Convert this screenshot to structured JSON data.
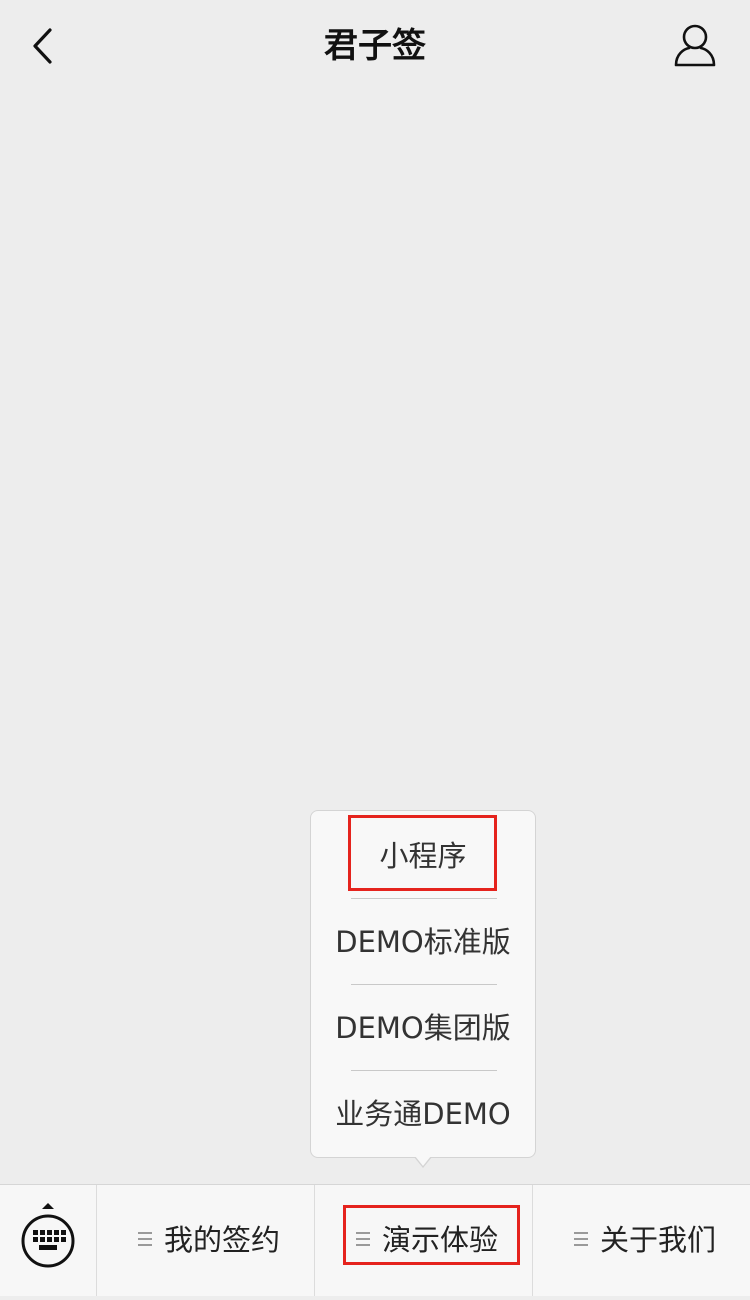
{
  "header": {
    "back_icon": "chevron-left-icon",
    "title": "君子签",
    "profile_icon": "user-icon"
  },
  "popup_menu": {
    "items": [
      {
        "label": "小程序",
        "highlighted": true
      },
      {
        "label": "DEMO标准版",
        "highlighted": false
      },
      {
        "label": "DEMO集团版",
        "highlighted": false
      },
      {
        "label": "业务通DEMO",
        "highlighted": false
      }
    ]
  },
  "bottom_bar": {
    "keyboard_icon": "keyboard-icon",
    "items": [
      {
        "label": "我的签约",
        "icon": "menu-icon",
        "highlighted": false
      },
      {
        "label": "演示体验",
        "icon": "menu-icon",
        "highlighted": true
      },
      {
        "label": "关于我们",
        "icon": "menu-icon",
        "highlighted": false
      }
    ]
  },
  "colors": {
    "background": "#ededed",
    "highlight": "#e5231d",
    "bar_background": "#f7f7f7",
    "popup_background": "#f8f8f8"
  }
}
